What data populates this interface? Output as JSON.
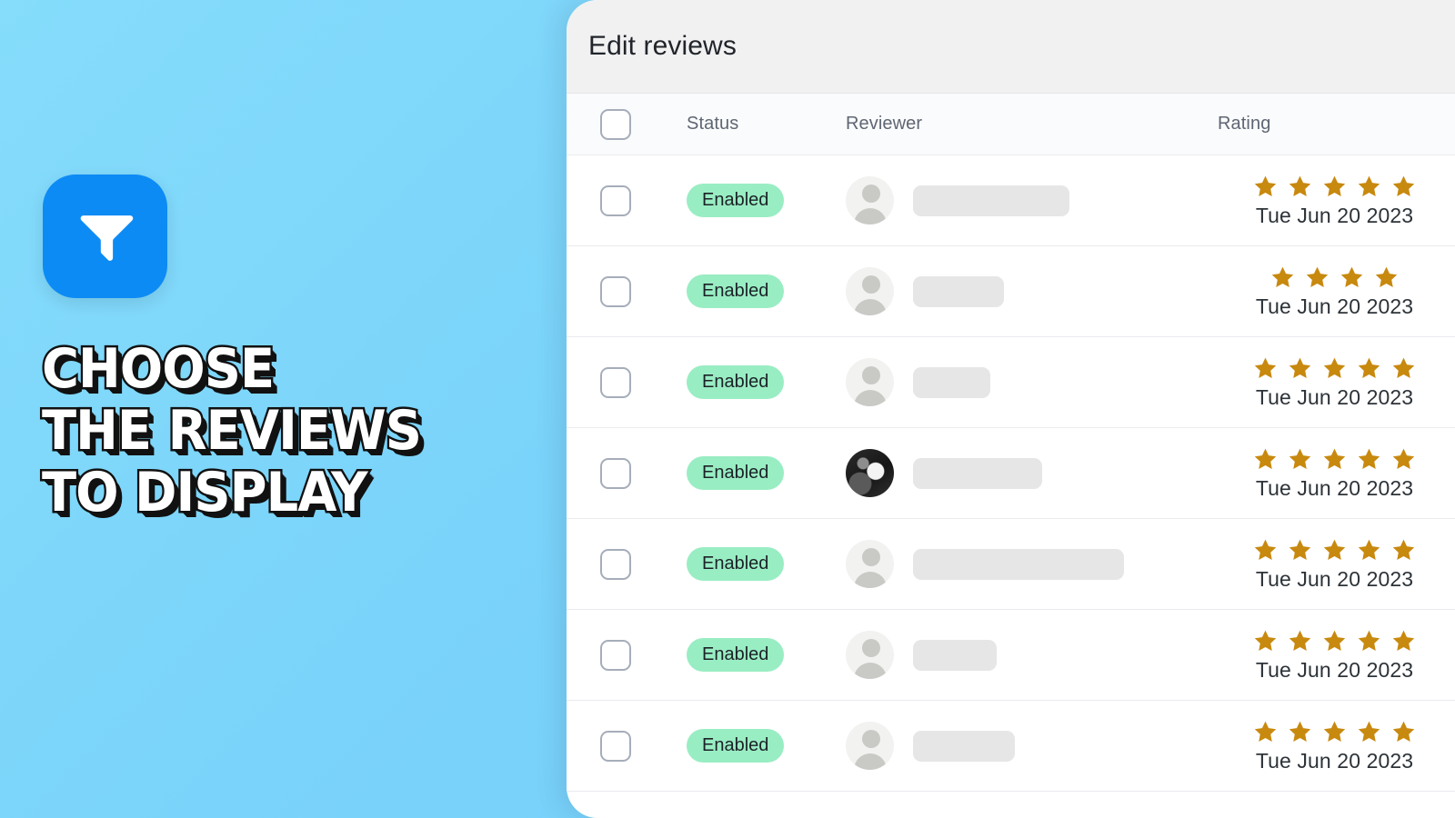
{
  "promo": {
    "icon_name": "filter-funnel-icon",
    "icon_bg": "#0d8bf5",
    "headline": "CHOOSE\nTHE REVIEWS\nTO DISPLAY",
    "background_color": "#7ad3fa"
  },
  "card": {
    "title": "Edit reviews",
    "header_bg": "#f1f1f2",
    "accent_badge_color": "#99edc3",
    "star_color": "#c8890f",
    "table": {
      "columns": [
        {
          "key": "select",
          "label": ""
        },
        {
          "key": "status",
          "label": "Status"
        },
        {
          "key": "reviewer",
          "label": "Reviewer"
        },
        {
          "key": "rating",
          "label": "Rating"
        }
      ],
      "select_all_checked": false,
      "rows": [
        {
          "checked": false,
          "status": "Enabled",
          "avatar": "placeholder-avatar",
          "name_width": 172,
          "stars": 5,
          "date": "Tue Jun 20 2023"
        },
        {
          "checked": false,
          "status": "Enabled",
          "avatar": "placeholder-avatar",
          "name_width": 100,
          "stars": 4,
          "date": "Tue Jun 20 2023"
        },
        {
          "checked": false,
          "status": "Enabled",
          "avatar": "placeholder-avatar",
          "name_width": 85,
          "stars": 5,
          "date": "Tue Jun 20 2023"
        },
        {
          "checked": false,
          "status": "Enabled",
          "avatar": "photo-avatar",
          "name_width": 142,
          "stars": 5,
          "date": "Tue Jun 20 2023"
        },
        {
          "checked": false,
          "status": "Enabled",
          "avatar": "placeholder-avatar",
          "name_width": 232,
          "stars": 5,
          "date": "Tue Jun 20 2023"
        },
        {
          "checked": false,
          "status": "Enabled",
          "avatar": "placeholder-avatar",
          "name_width": 92,
          "stars": 5,
          "date": "Tue Jun 20 2023"
        },
        {
          "checked": false,
          "status": "Enabled",
          "avatar": "placeholder-avatar",
          "name_width": 112,
          "stars": 5,
          "date": "Tue Jun 20 2023"
        }
      ]
    }
  }
}
